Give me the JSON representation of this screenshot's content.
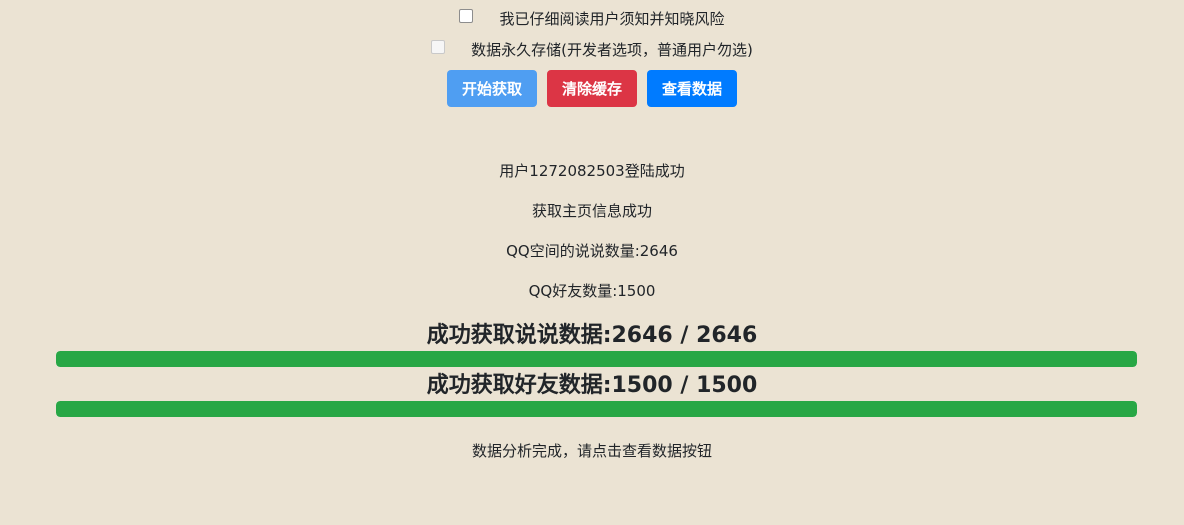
{
  "consent": {
    "read_notice_label": "我已仔细阅读用户须知并知晓风险",
    "read_notice_checked": false,
    "persist_label": "数据永久存储(开发者选项，普通用户勿选)",
    "persist_checked": false
  },
  "buttons": {
    "start_label": "开始获取",
    "clear_label": "清除缓存",
    "view_label": "查看数据"
  },
  "log": {
    "line1": "用户1272082503登陆成功",
    "line2": "获取主页信息成功",
    "line3": "QQ空间的说说数量:2646",
    "line4": "QQ好友数量:1500"
  },
  "progress": {
    "shuoshuo_title": "成功获取说说数据:2646 / 2646",
    "shuoshuo_fraction": 1.0,
    "friends_title": "成功获取好友数据:1500 / 1500",
    "friends_fraction": 1.0
  },
  "status": {
    "done_message": "数据分析完成，请点击查看数据按钮"
  },
  "colors": {
    "background": "#ebe3d3",
    "start_button": "#4f9ef2",
    "clear_button": "#dc3545",
    "view_button": "#007bff",
    "progress_fill": "#28a745"
  }
}
